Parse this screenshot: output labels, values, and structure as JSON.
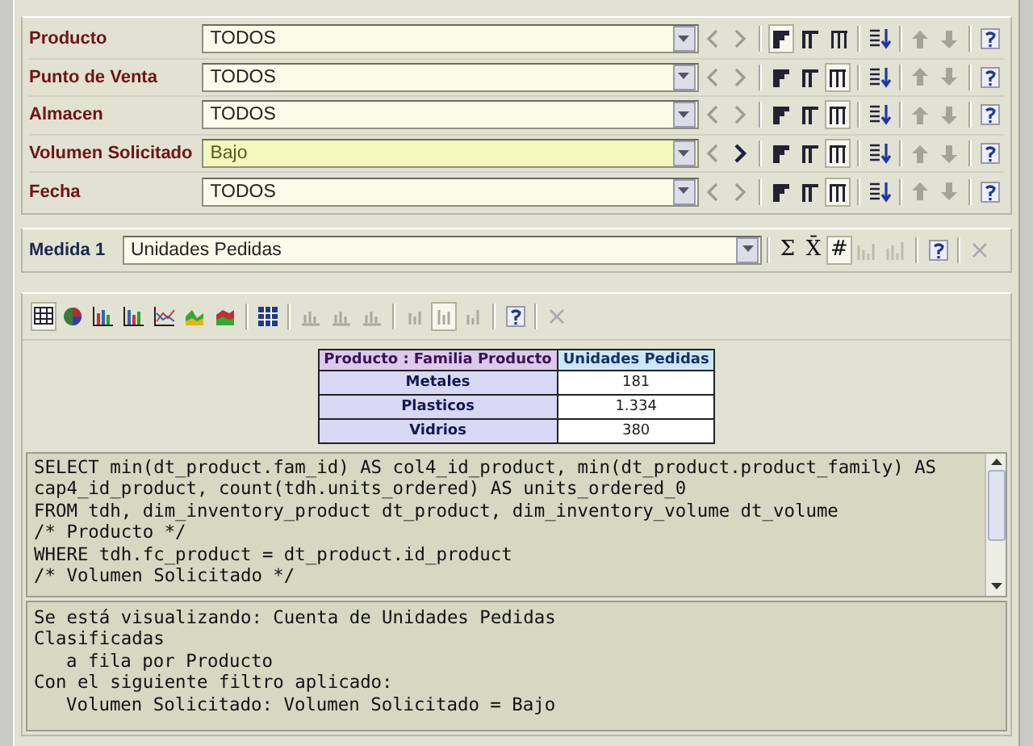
{
  "filters": [
    {
      "label": "Producto",
      "value": "TODOS",
      "filtered": false,
      "next_enabled": false,
      "layouts": [
        {
          "selected": true
        },
        {
          "selected": false
        },
        {
          "selected": false
        }
      ]
    },
    {
      "label": "Punto de Venta",
      "value": "TODOS",
      "filtered": false,
      "next_enabled": false,
      "layouts": [
        {
          "selected": false
        },
        {
          "selected": false
        },
        {
          "selected": true
        }
      ]
    },
    {
      "label": "Almacen",
      "value": "TODOS",
      "filtered": false,
      "next_enabled": false,
      "layouts": [
        {
          "selected": false
        },
        {
          "selected": false
        },
        {
          "selected": true
        }
      ]
    },
    {
      "label": "Volumen Solicitado",
      "value": "Bajo",
      "filtered": true,
      "next_enabled": true,
      "layouts": [
        {
          "selected": false
        },
        {
          "selected": false
        },
        {
          "selected": true
        }
      ]
    },
    {
      "label": "Fecha",
      "value": "TODOS",
      "filtered": false,
      "next_enabled": false,
      "layouts": [
        {
          "selected": false
        },
        {
          "selected": false
        },
        {
          "selected": true
        }
      ]
    }
  ],
  "measure": {
    "label": "Medida 1",
    "value": "Unidades Pedidas",
    "functions": [
      {
        "symbol": "Σ",
        "selected": false
      },
      {
        "symbol": "X̄",
        "selected": false
      },
      {
        "symbol": "#",
        "selected": true
      }
    ]
  },
  "table": {
    "columns": [
      "Producto : Familia Producto",
      "Unidades Pedidas"
    ],
    "rows": [
      [
        "Metales",
        "181"
      ],
      [
        "Plasticos",
        "1.334"
      ],
      [
        "Vidrios",
        "380"
      ]
    ]
  },
  "sql": [
    "SELECT min(dt_product.fam_id) AS col4_id_product, min(dt_product.product_family) AS",
    "cap4_id_product, count(tdh.units_ordered) AS units_ordered_0",
    "FROM tdh, dim_inventory_product dt_product, dim_inventory_volume dt_volume",
    "/* Producto */",
    "WHERE tdh.fc_product = dt_product.id_product",
    "/* Volumen Solicitado */"
  ],
  "summary": [
    {
      "text": "Se está visualizando: Cuenta de Unidades Pedidas"
    },
    {
      "text": "Clasificadas",
      "children": [
        {
          "text": "a fila por Producto"
        }
      ]
    },
    {
      "text": "Con el siguiente filtro aplicado:",
      "children": [
        {
          "text": "Volumen Solicitado: Volumen Solicitado = Bajo"
        }
      ]
    }
  ]
}
